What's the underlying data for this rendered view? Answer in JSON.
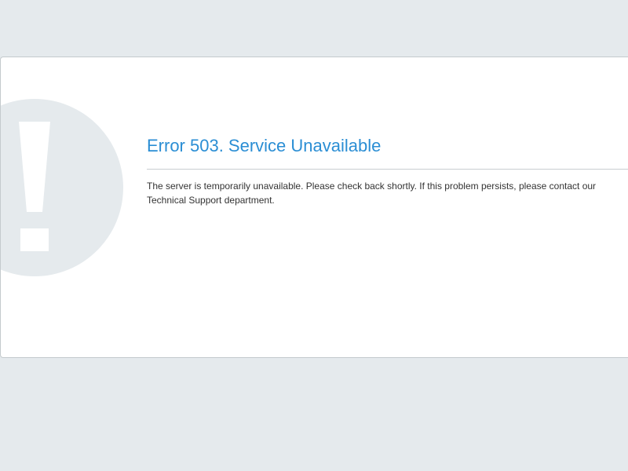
{
  "error": {
    "title": "Error 503. Service Unavailable",
    "message": "The server is temporarily unavailable. Please check back shortly. If this problem persists, please contact our Technical Support department.",
    "icon": "exclamation-icon"
  },
  "colors": {
    "page_background": "#e5eaed",
    "panel_background": "#ffffff",
    "title": "#2b8ed4",
    "icon_circle": "#e5eaed"
  }
}
